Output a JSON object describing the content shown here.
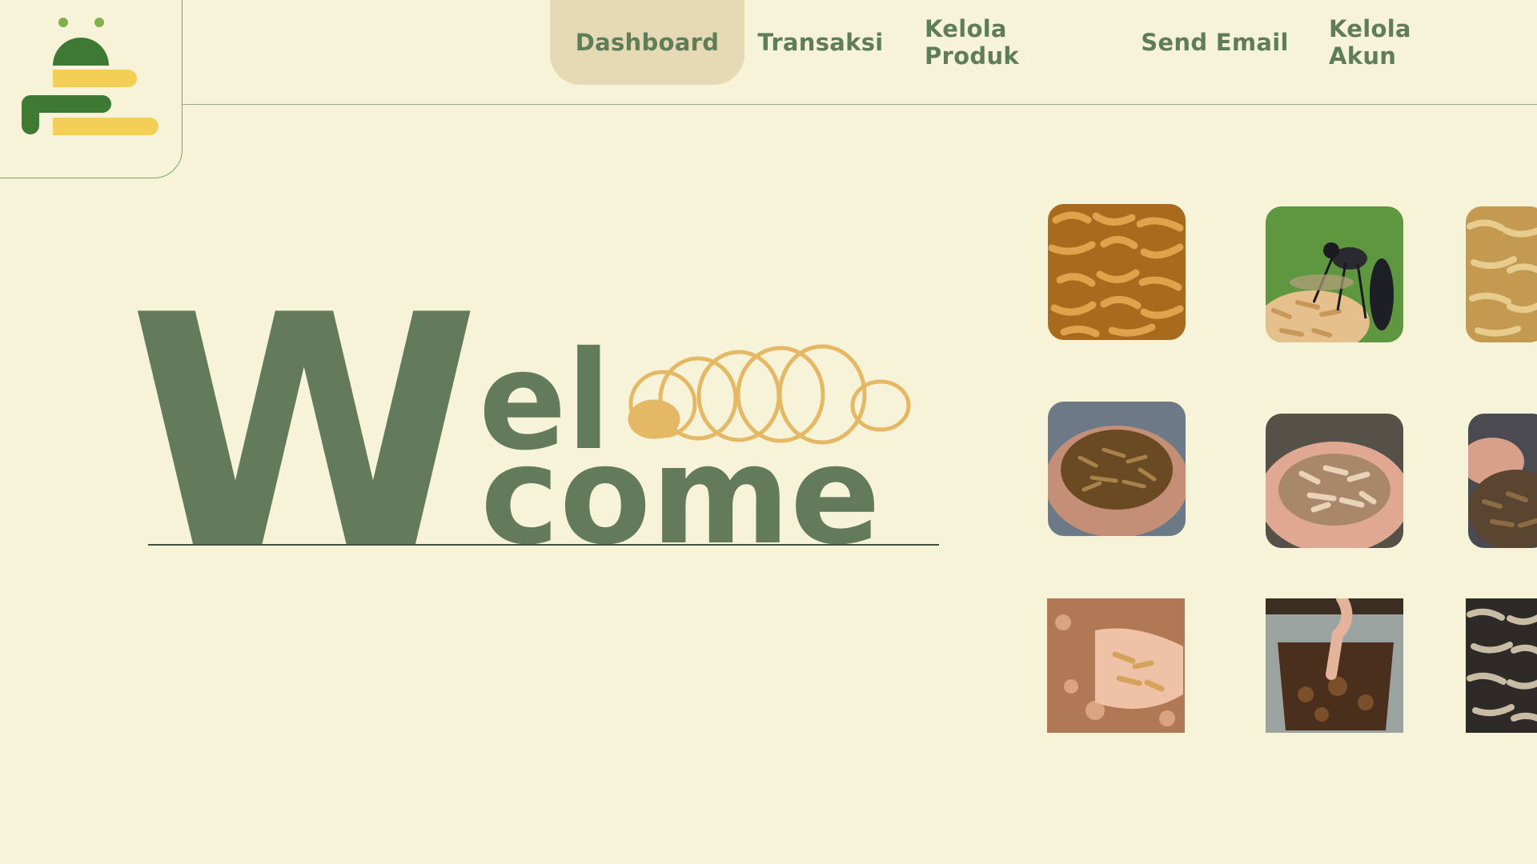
{
  "logo": {
    "icon": "larva-logo-icon",
    "colors": {
      "green": "#3f7a35",
      "light_green": "#7fb04b",
      "yellow": "#f3cf56"
    }
  },
  "nav": {
    "items": [
      {
        "label": "Dashboard",
        "active": true
      },
      {
        "label": "Transaksi",
        "active": false
      },
      {
        "label": "Kelola Produk",
        "active": false
      },
      {
        "label": "Send Email",
        "active": false
      },
      {
        "label": "Kelola Akun",
        "active": false
      }
    ]
  },
  "hero": {
    "big_letter": "W",
    "line1": "el",
    "line2": "come",
    "colors": {
      "text": "#637b5b",
      "larva": "#e4b865"
    }
  },
  "gallery": {
    "images": [
      {
        "subject": "mealworm-pile-photo"
      },
      {
        "subject": "black-soldier-fly-photo"
      },
      {
        "subject": "maggot-pile-photo"
      },
      {
        "subject": "dried-larvae-in-hands-photo"
      },
      {
        "subject": "larvae-in-hands-photo"
      },
      {
        "subject": "larvae-handful-photo"
      },
      {
        "subject": "larvae-on-substrate-photo"
      },
      {
        "subject": "larvae-in-tray-photo"
      },
      {
        "subject": "dark-larvae-pile-photo"
      }
    ]
  },
  "colors": {
    "background": "#f6f3d8",
    "nav_active": "#e6d9b6",
    "nav_text": "#5f7e58",
    "border": "#8fb07c"
  }
}
